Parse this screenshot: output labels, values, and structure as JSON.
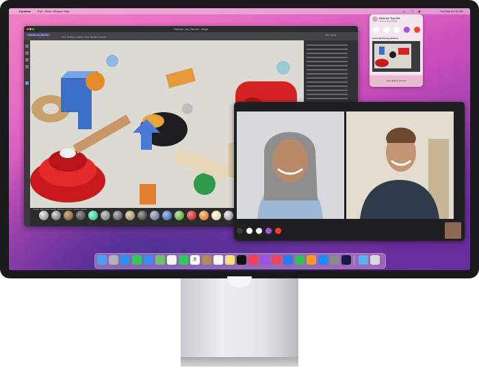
{
  "menubar": {
    "app_name": "Facetime",
    "items": [
      "Edit",
      "Video",
      "Window",
      "Help"
    ],
    "clock": "Tue Mar 8 9:41 AM"
  },
  "maya": {
    "window_title": "Science_toy_Set.mb - Maya",
    "tab_label": "Science_toy_Set.mb",
    "viewport_menu": [
      "View",
      "Shading",
      "Lighting",
      "Show",
      "Renderer",
      "Panels"
    ],
    "outliner_header": "Main Layout",
    "shelf_menu": [
      "Create",
      "Edit",
      "View",
      "Select",
      "Material",
      "Texture",
      "Cache",
      "Global"
    ]
  },
  "share_popup": {
    "title": "Science Toy Set",
    "subtitle": "Sharing My Window",
    "section_label": "Currently Sharing Window",
    "stop_label": "Stop Sharing Window"
  },
  "facetime": {
    "controls": [
      "sidebar-icon",
      "mic-icon",
      "video-icon",
      "share-icon",
      "end-call-icon"
    ]
  },
  "dock": {
    "icons": [
      "finder",
      "launchpad",
      "safari",
      "messages",
      "mail",
      "maps",
      "photos",
      "facetime",
      "calendar",
      "contacts",
      "reminders",
      "notes",
      "tv",
      "music",
      "podcasts",
      "news",
      "keynote",
      "numbers",
      "pages",
      "app-store",
      "system-preferences",
      "cinema4d",
      "downloads",
      "trash"
    ],
    "calendar_day": "8"
  },
  "colors": {
    "wallpaper_pink": "#e46bc4",
    "wallpaper_purple": "#4c2b8f",
    "end_call_red": "#ff3b30"
  }
}
